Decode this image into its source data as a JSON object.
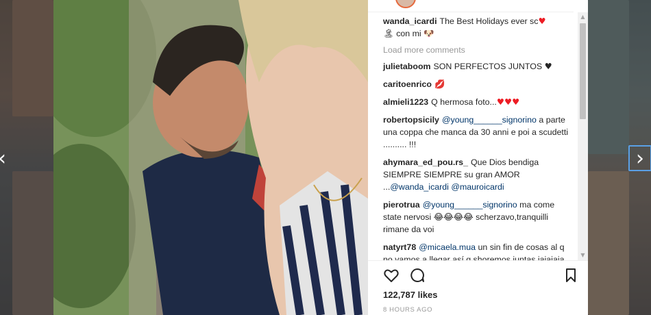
{
  "post": {
    "caption": {
      "user": "wanda_icardi",
      "text_line1": "The Best Holidays ever sc",
      "text_line2": "con mi"
    },
    "load_more": "Load more comments",
    "comments": [
      {
        "user": "julietaboom",
        "text": "SON PERFECTOS JUNTOS",
        "emoji": "♥"
      },
      {
        "user": "caritoenrico",
        "text": "",
        "emoji": "💋"
      },
      {
        "user": "almieli1223",
        "text": "Q hermosa foto...",
        "emoji": "♥♥♥"
      },
      {
        "user": "robertopsicily",
        "mention": "@young______signorino",
        "text": "a parte una coppa che manca da 30 anni e poi a scudetti .......... !!!"
      },
      {
        "user": "ahymara_ed_pou.rs_",
        "text": "Que Dios bendiga SIEMPRE SIEMPRE su gran AMOR ...",
        "mention1": "@wanda_icardi",
        "mention2": "@mauroicardi"
      },
      {
        "user": "pierotrua",
        "mention": "@young______signorino",
        "text": "ma come state nervosi",
        "emoji": "😂😂😂😂",
        "text2": "scherzavo,tranquilli rimane da voi"
      },
      {
        "user": "natyrt78",
        "mention": "@micaela.mua",
        "text": "un sin fin de cosas al q no vamos a llegar así q shoremos juntas jajajaja"
      }
    ],
    "likes": "122,787 likes",
    "time": "8 HOURS AGO"
  },
  "icons": {
    "heart": "heart-icon",
    "comment": "comment-icon",
    "bookmark": "bookmark-icon",
    "prev": "chevron-left-icon",
    "next": "chevron-right-icon"
  },
  "colors": {
    "username": "#262626",
    "mention": "#003569",
    "muted": "#999999",
    "overlay": "#5f5f5f",
    "focus": "#5aa0e6"
  }
}
